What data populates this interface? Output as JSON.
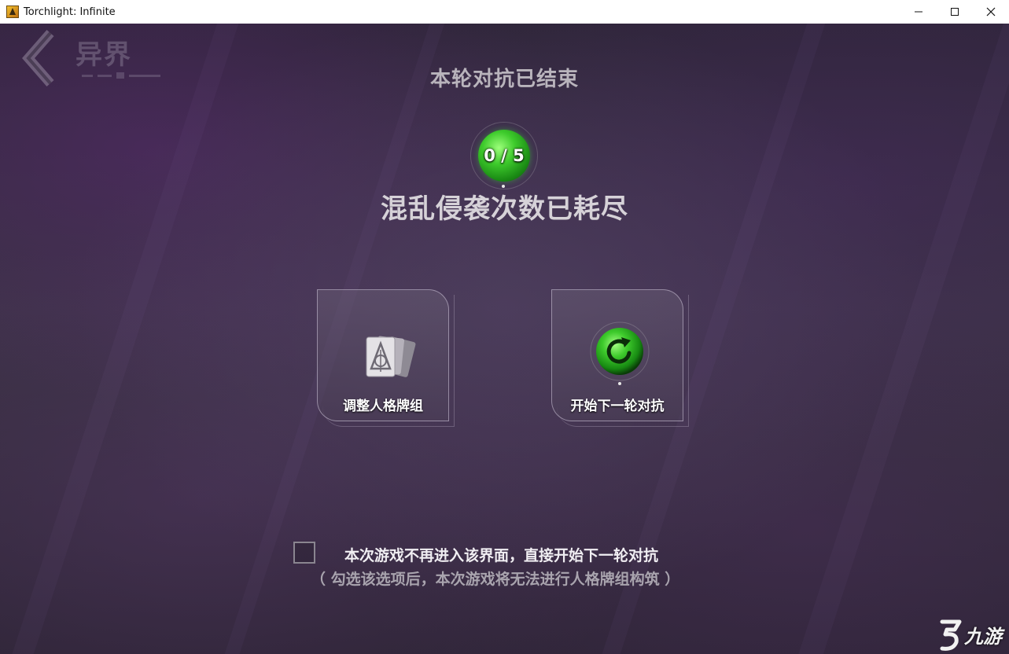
{
  "window": {
    "title": "Torchlight: Infinite",
    "icon": "torchlight-app-icon",
    "controls": [
      "minimize-icon",
      "maximize-icon",
      "close-icon"
    ]
  },
  "top_bar": {
    "back_icon": "chevron-left-icon",
    "mode_label": "异界"
  },
  "header": {
    "title": "本轮对抗已结束",
    "counter_text": "0 / 5",
    "counter_value": 0,
    "counter_max": 5,
    "message": "混乱侵袭次数已耗尽"
  },
  "actions": {
    "adjust_deck": {
      "label": "调整人格牌组",
      "icon": "card-deck-icon"
    },
    "next_round": {
      "label": "开始下一轮对抗",
      "icon": "refresh-icon"
    }
  },
  "option": {
    "checked": false,
    "label": "本次游戏不再进入该界面，直接开始下一轮对抗",
    "note": "（ 勾选该选项后，本次游戏将无法进行人格牌组构筑 ）"
  },
  "watermark": {
    "text": "九游"
  },
  "colors": {
    "accent_green": "#3ecb2c",
    "background": "#3a3244",
    "text_primary": "#f0eef2",
    "text_muted": "#a9a4ae"
  }
}
